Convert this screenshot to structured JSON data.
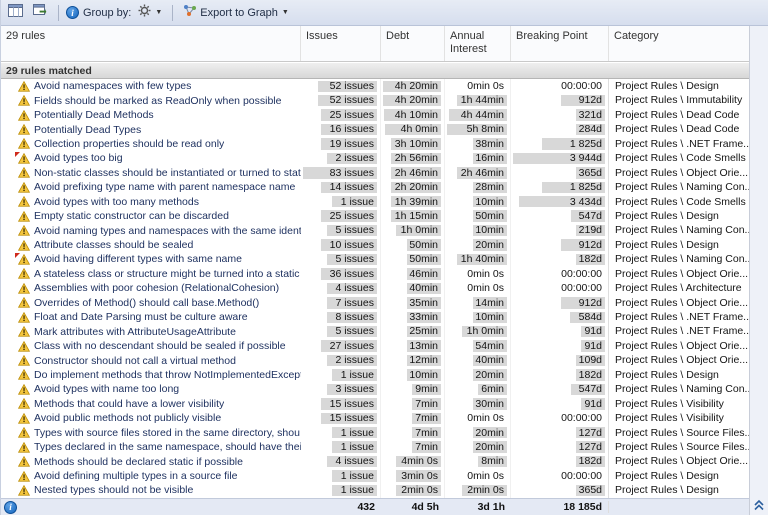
{
  "toolbar": {
    "group_by_label": "Group by:",
    "export_to_graph_label": "Export to Graph"
  },
  "header": {
    "rules": "29 rules",
    "issues": "Issues",
    "debt": "Debt",
    "interest": "Annual Interest",
    "breaking_point": "Breaking Point",
    "category": "Category"
  },
  "group": {
    "label": "29 rules matched"
  },
  "colors": {
    "bar": "#d8d8d8",
    "warning": "#f4c63f",
    "accent": "#2b5f9e"
  },
  "table": {
    "maxes": {
      "issues": 83,
      "debt": 260,
      "interest": 308,
      "bp": 3944
    },
    "rows": [
      {
        "name": "Avoid namespaces with few types",
        "flag": false,
        "issues": {
          "t": "52 issues",
          "v": 52
        },
        "debt": {
          "t": "4h 20min",
          "v": 260
        },
        "interest": {
          "t": "0min 0s",
          "v": 0
        },
        "bp": {
          "t": "00:00:00",
          "v": 0
        },
        "category": "Project Rules \\ Design"
      },
      {
        "name": "Fields should be marked as ReadOnly when possible",
        "flag": false,
        "issues": {
          "t": "52 issues",
          "v": 52
        },
        "debt": {
          "t": "4h 20min",
          "v": 260
        },
        "interest": {
          "t": "1h 44min",
          "v": 104
        },
        "bp": {
          "t": "912d",
          "v": 912
        },
        "category": "Project Rules \\ Immutability"
      },
      {
        "name": "Potentially Dead Methods",
        "flag": false,
        "issues": {
          "t": "25 issues",
          "v": 25
        },
        "debt": {
          "t": "4h 10min",
          "v": 250
        },
        "interest": {
          "t": "4h 44min",
          "v": 284
        },
        "bp": {
          "t": "321d",
          "v": 321
        },
        "category": "Project Rules \\ Dead Code"
      },
      {
        "name": "Potentially Dead Types",
        "flag": false,
        "issues": {
          "t": "16 issues",
          "v": 16
        },
        "debt": {
          "t": "4h 0min",
          "v": 240
        },
        "interest": {
          "t": "5h 8min",
          "v": 308
        },
        "bp": {
          "t": "284d",
          "v": 284
        },
        "category": "Project Rules \\ Dead Code"
      },
      {
        "name": "Collection properties should be read only",
        "flag": false,
        "issues": {
          "t": "19 issues",
          "v": 19
        },
        "debt": {
          "t": "3h 10min",
          "v": 190
        },
        "interest": {
          "t": "38min",
          "v": 38
        },
        "bp": {
          "t": "1 825d",
          "v": 1825
        },
        "category": "Project Rules \\ .NET Frame..."
      },
      {
        "name": "Avoid types too big",
        "flag": true,
        "issues": {
          "t": "2 issues",
          "v": 2
        },
        "debt": {
          "t": "2h 56min",
          "v": 176
        },
        "interest": {
          "t": "16min",
          "v": 16
        },
        "bp": {
          "t": "3 944d",
          "v": 3944
        },
        "category": "Project Rules \\ Code Smells"
      },
      {
        "name": "Non-static classes should be instantiated or turned to stat",
        "flag": false,
        "issues": {
          "t": "83 issues",
          "v": 83
        },
        "debt": {
          "t": "2h 46min",
          "v": 166
        },
        "interest": {
          "t": "2h 46min",
          "v": 166
        },
        "bp": {
          "t": "365d",
          "v": 365
        },
        "category": "Project Rules \\ Object Orie..."
      },
      {
        "name": "Avoid prefixing type name with parent namespace name",
        "flag": false,
        "issues": {
          "t": "14 issues",
          "v": 14
        },
        "debt": {
          "t": "2h 20min",
          "v": 140
        },
        "interest": {
          "t": "28min",
          "v": 28
        },
        "bp": {
          "t": "1 825d",
          "v": 1825
        },
        "category": "Project Rules \\ Naming Con..."
      },
      {
        "name": "Avoid types with too many methods",
        "flag": false,
        "issues": {
          "t": "1 issue",
          "v": 1
        },
        "debt": {
          "t": "1h 39min",
          "v": 99
        },
        "interest": {
          "t": "10min",
          "v": 10
        },
        "bp": {
          "t": "3 434d",
          "v": 3434
        },
        "category": "Project Rules \\ Code Smells"
      },
      {
        "name": "Empty static constructor can be discarded",
        "flag": false,
        "issues": {
          "t": "25 issues",
          "v": 25
        },
        "debt": {
          "t": "1h 15min",
          "v": 75
        },
        "interest": {
          "t": "50min",
          "v": 50
        },
        "bp": {
          "t": "547d",
          "v": 547
        },
        "category": "Project Rules \\ Design"
      },
      {
        "name": "Avoid naming types and namespaces with the same ident",
        "flag": false,
        "issues": {
          "t": "5 issues",
          "v": 5
        },
        "debt": {
          "t": "1h 0min",
          "v": 60
        },
        "interest": {
          "t": "10min",
          "v": 10
        },
        "bp": {
          "t": "219d",
          "v": 219
        },
        "category": "Project Rules \\ Naming Con..."
      },
      {
        "name": "Attribute classes should be sealed",
        "flag": false,
        "issues": {
          "t": "10 issues",
          "v": 10
        },
        "debt": {
          "t": "50min",
          "v": 50
        },
        "interest": {
          "t": "20min",
          "v": 20
        },
        "bp": {
          "t": "912d",
          "v": 912
        },
        "category": "Project Rules \\ Design"
      },
      {
        "name": "Avoid having different types with same name",
        "flag": true,
        "issues": {
          "t": "5 issues",
          "v": 5
        },
        "debt": {
          "t": "50min",
          "v": 50
        },
        "interest": {
          "t": "1h 40min",
          "v": 100
        },
        "bp": {
          "t": "182d",
          "v": 182
        },
        "category": "Project Rules \\ Naming Con..."
      },
      {
        "name": "A stateless class or structure might be turned into a static",
        "flag": false,
        "issues": {
          "t": "36 issues",
          "v": 36
        },
        "debt": {
          "t": "46min",
          "v": 46
        },
        "interest": {
          "t": "0min 0s",
          "v": 0
        },
        "bp": {
          "t": "00:00:00",
          "v": 0
        },
        "category": "Project Rules \\ Object Orie..."
      },
      {
        "name": "Assemblies with poor cohesion (RelationalCohesion)",
        "flag": false,
        "issues": {
          "t": "4 issues",
          "v": 4
        },
        "debt": {
          "t": "40min",
          "v": 40
        },
        "interest": {
          "t": "0min 0s",
          "v": 0
        },
        "bp": {
          "t": "00:00:00",
          "v": 0
        },
        "category": "Project Rules \\ Architecture"
      },
      {
        "name": "Overrides of Method() should call base.Method()",
        "flag": false,
        "issues": {
          "t": "7 issues",
          "v": 7
        },
        "debt": {
          "t": "35min",
          "v": 35
        },
        "interest": {
          "t": "14min",
          "v": 14
        },
        "bp": {
          "t": "912d",
          "v": 912
        },
        "category": "Project Rules \\ Object Orie..."
      },
      {
        "name": "Float and Date Parsing must be culture aware",
        "flag": false,
        "issues": {
          "t": "8 issues",
          "v": 8
        },
        "debt": {
          "t": "33min",
          "v": 33
        },
        "interest": {
          "t": "10min",
          "v": 10
        },
        "bp": {
          "t": "584d",
          "v": 584
        },
        "category": "Project Rules \\ .NET Frame..."
      },
      {
        "name": "Mark attributes with AttributeUsageAttribute",
        "flag": false,
        "issues": {
          "t": "5 issues",
          "v": 5
        },
        "debt": {
          "t": "25min",
          "v": 25
        },
        "interest": {
          "t": "1h 0min",
          "v": 60
        },
        "bp": {
          "t": "91d",
          "v": 91
        },
        "category": "Project Rules \\ .NET Frame..."
      },
      {
        "name": "Class with no descendant should be sealed if possible",
        "flag": false,
        "issues": {
          "t": "27 issues",
          "v": 27
        },
        "debt": {
          "t": "13min",
          "v": 13
        },
        "interest": {
          "t": "54min",
          "v": 54
        },
        "bp": {
          "t": "91d",
          "v": 91
        },
        "category": "Project Rules \\ Object Orie..."
      },
      {
        "name": "Constructor should not call a virtual method",
        "flag": false,
        "issues": {
          "t": "2 issues",
          "v": 2
        },
        "debt": {
          "t": "12min",
          "v": 12
        },
        "interest": {
          "t": "40min",
          "v": 40
        },
        "bp": {
          "t": "109d",
          "v": 109
        },
        "category": "Project Rules \\ Object Orie..."
      },
      {
        "name": "Do implement methods that throw NotImplementedExcepti",
        "flag": false,
        "issues": {
          "t": "1 issue",
          "v": 1
        },
        "debt": {
          "t": "10min",
          "v": 10
        },
        "interest": {
          "t": "20min",
          "v": 20
        },
        "bp": {
          "t": "182d",
          "v": 182
        },
        "category": "Project Rules \\ Design"
      },
      {
        "name": "Avoid types with name too long",
        "flag": false,
        "issues": {
          "t": "3 issues",
          "v": 3
        },
        "debt": {
          "t": "9min",
          "v": 9
        },
        "interest": {
          "t": "6min",
          "v": 6
        },
        "bp": {
          "t": "547d",
          "v": 547
        },
        "category": "Project Rules \\ Naming Con..."
      },
      {
        "name": "Methods that could have a lower visibility",
        "flag": false,
        "issues": {
          "t": "15 issues",
          "v": 15
        },
        "debt": {
          "t": "7min",
          "v": 7
        },
        "interest": {
          "t": "30min",
          "v": 30
        },
        "bp": {
          "t": "91d",
          "v": 91
        },
        "category": "Project Rules \\ Visibility"
      },
      {
        "name": "Avoid public methods not publicly visible",
        "flag": false,
        "issues": {
          "t": "15 issues",
          "v": 15
        },
        "debt": {
          "t": "7min",
          "v": 7
        },
        "interest": {
          "t": "0min 0s",
          "v": 0
        },
        "bp": {
          "t": "00:00:00",
          "v": 0
        },
        "category": "Project Rules \\ Visibility"
      },
      {
        "name": "Types with source files stored in the same directory, shou",
        "flag": false,
        "issues": {
          "t": "1 issue",
          "v": 1
        },
        "debt": {
          "t": "7min",
          "v": 7
        },
        "interest": {
          "t": "20min",
          "v": 20
        },
        "bp": {
          "t": "127d",
          "v": 127
        },
        "category": "Project Rules \\ Source Files..."
      },
      {
        "name": "Types declared in the same namespace, should have thei",
        "flag": false,
        "issues": {
          "t": "1 issue",
          "v": 1
        },
        "debt": {
          "t": "7min",
          "v": 7
        },
        "interest": {
          "t": "20min",
          "v": 20
        },
        "bp": {
          "t": "127d",
          "v": 127
        },
        "category": "Project Rules \\ Source Files..."
      },
      {
        "name": "Methods should be declared static if possible",
        "flag": false,
        "issues": {
          "t": "4 issues",
          "v": 4
        },
        "debt": {
          "t": "4min 0s",
          "v": 4
        },
        "interest": {
          "t": "8min",
          "v": 8
        },
        "bp": {
          "t": "182d",
          "v": 182
        },
        "category": "Project Rules \\ Object Orie..."
      },
      {
        "name": "Avoid defining multiple types in a source file",
        "flag": false,
        "issues": {
          "t": "1 issue",
          "v": 1
        },
        "debt": {
          "t": "3min 0s",
          "v": 3
        },
        "interest": {
          "t": "0min 0s",
          "v": 0
        },
        "bp": {
          "t": "00:00:00",
          "v": 0
        },
        "category": "Project Rules \\ Design"
      },
      {
        "name": "Nested types should not be visible",
        "flag": false,
        "issues": {
          "t": "1 issue",
          "v": 1
        },
        "debt": {
          "t": "2min 0s",
          "v": 2
        },
        "interest": {
          "t": "2min 0s",
          "v": 2
        },
        "bp": {
          "t": "365d",
          "v": 365
        },
        "category": "Project Rules \\ Design"
      }
    ]
  },
  "footer": {
    "issues_total": "432",
    "debt_total": "4d 5h",
    "interest_total": "3d 1h",
    "bp_total": "18 185d"
  }
}
